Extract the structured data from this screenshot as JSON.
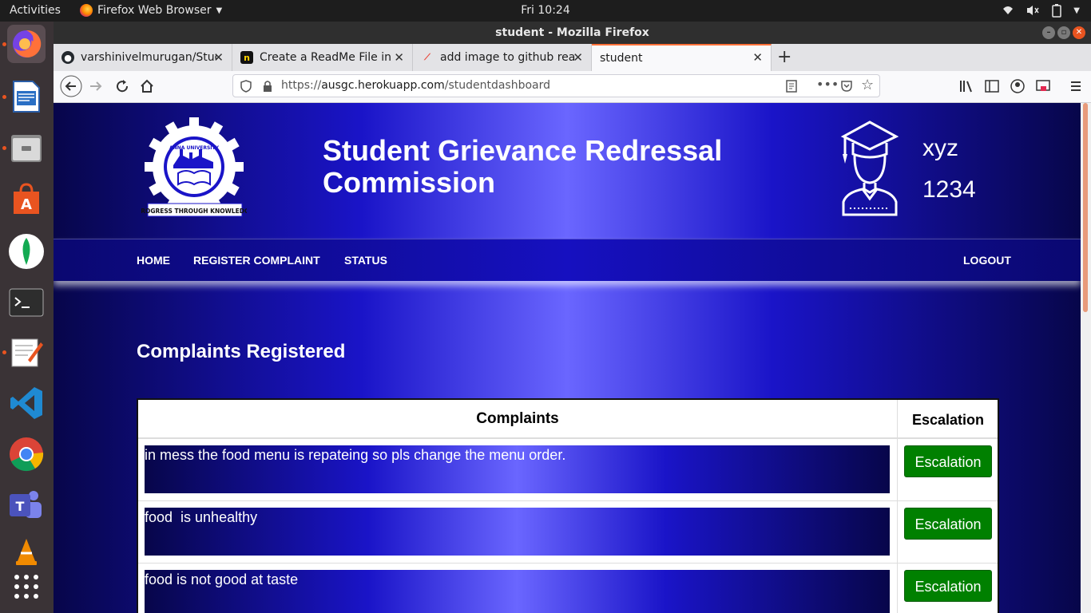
{
  "os_topbar": {
    "activities": "Activities",
    "app_name": "Firefox Web Browser",
    "clock": "Fri 10:24"
  },
  "dock": {
    "items": [
      "firefox-icon",
      "libreoffice-writer-icon",
      "files-icon",
      "software-center-icon",
      "mongodb-compass-icon",
      "terminal-icon",
      "text-editor-icon",
      "vscode-icon",
      "chrome-icon",
      "teams-icon",
      "vlc-icon",
      "app-grid-icon"
    ]
  },
  "window": {
    "title": "student - Mozilla Firefox"
  },
  "tabs": [
    {
      "label": "varshinivelmurugan/Stud",
      "icon": "github-icon"
    },
    {
      "label": "Create a ReadMe File in",
      "icon": "notion-icon"
    },
    {
      "label": "add image to github read",
      "icon": "google-icon"
    },
    {
      "label": "student",
      "icon": "",
      "active": true
    }
  ],
  "address_bar": {
    "url_prefix": "https://",
    "url_host": "ausgc.herokuapp.com",
    "url_path": "/studentdashboard"
  },
  "page": {
    "logo_text_top": "ANNA UNIVERSITY",
    "logo_text_bottom": "PROGRESS THROUGH KNOWLEDGE",
    "site_title": "Student Grievance Redressal Commission",
    "user_name": "xyz",
    "user_id": "1234",
    "nav": {
      "home": "HOME",
      "register": "REGISTER COMPLAINT",
      "status": "STATUS",
      "logout": "LOGOUT"
    },
    "section_title": "Complaints Registered",
    "table": {
      "col_complaints": "Complaints",
      "col_escalation": "Escalation",
      "rows": [
        {
          "complaint": "in mess the food menu is repateing so pls change the menu order.",
          "button": "Escalation"
        },
        {
          "complaint": "food  is unhealthy",
          "button": "Escalation"
        },
        {
          "complaint": "food is not good at taste",
          "button": "Escalation"
        }
      ]
    }
  },
  "colors": {
    "page_gradient_dark": "#07064a",
    "page_gradient_mid": "#1a14c8",
    "page_gradient_light": "#6a66ff",
    "escalation_button": "#008000",
    "firefox_accent": "#ff7139"
  }
}
